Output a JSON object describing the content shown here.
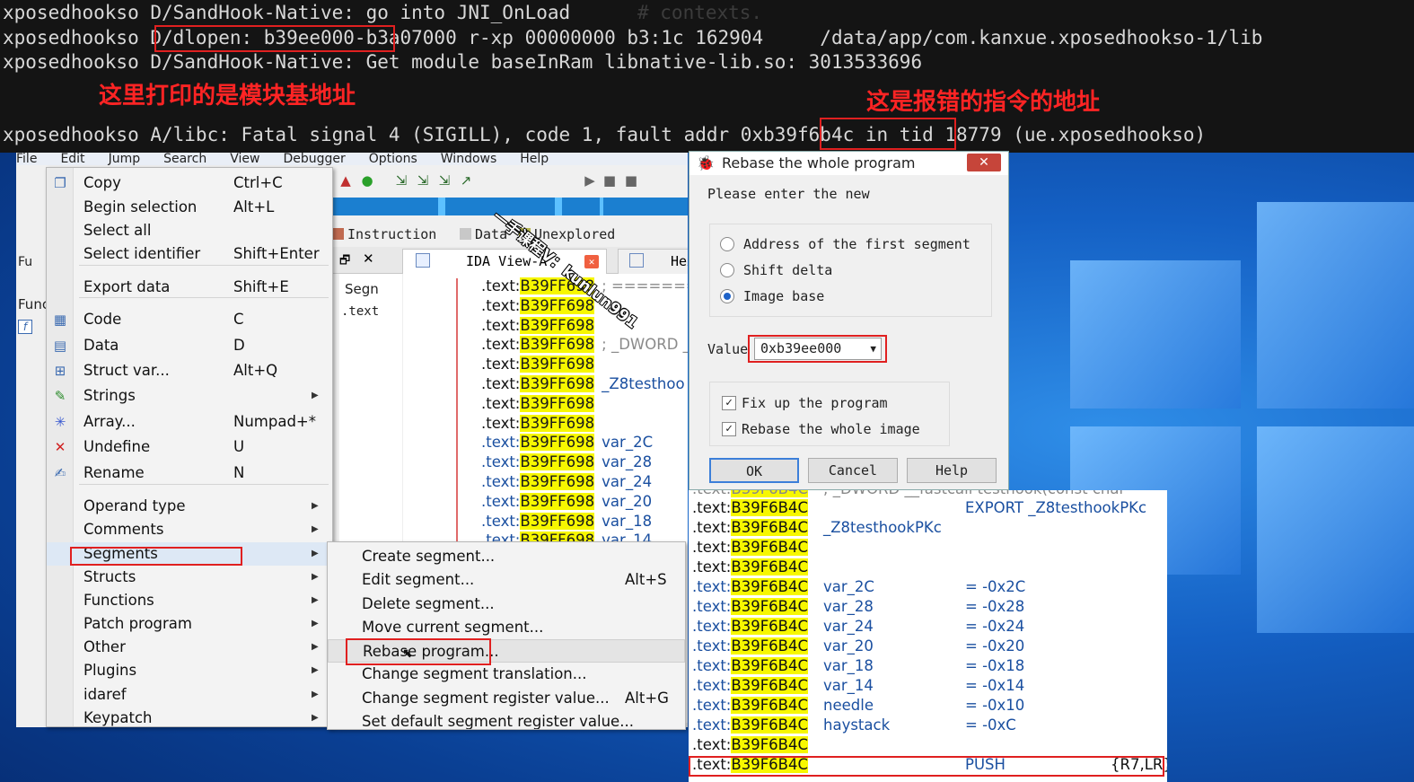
{
  "terminal": {
    "lines": [
      "xposedhookso D/SandHook-Native: go into JNI_OnLoad",
      "xposedhookso D/dlopen: b39ee000-b3a07000 r-xp 00000000 b3:1c 162904     /data/app/com.kanxue.xposedhookso-1/lib",
      "xposedhookso D/SandHook-Native: Get module baseInRam libnative-lib.so: 3013533696",
      "xposedhookso A/libc: Fatal signal 4 (SIGILL), code 1, fault addr 0xb39f6b4c in tid 18779 (ue.xposedhookso)"
    ],
    "ghost": "# contexts.",
    "annotation_left": "这里打印的是模块基地址",
    "annotation_right": "这是报错的指令的地址"
  },
  "ida_menu": [
    "File",
    "Edit",
    "Jump",
    "Search",
    "View",
    "Debugger",
    "Options",
    "Windows",
    "Help"
  ],
  "legend": [
    "Instruction",
    "Data",
    "Unexplored"
  ],
  "tab_ida_view": "IDA View-A",
  "tab_hex": "Hex",
  "side": {
    "functions": "Fu",
    "func": "Func",
    "seg": "Segn",
    "segrow": ".text"
  },
  "disasm": {
    "prefix": ".text:",
    "addr": "B39FF698",
    "rows": [
      {
        "t": "cm",
        "text": "; ==========="
      },
      {
        "t": "",
        "text": ""
      },
      {
        "t": "",
        "text": ""
      },
      {
        "t": "cm",
        "text": "; _DWORD _"
      },
      {
        "t": "",
        "text": ""
      },
      {
        "t": "nm",
        "text": "_Z8testhoo"
      },
      {
        "t": "",
        "text": ""
      },
      {
        "t": "",
        "text": ""
      },
      {
        "t": "var",
        "text": "var_2C"
      },
      {
        "t": "var",
        "text": "var_28"
      },
      {
        "t": "var",
        "text": "var_24"
      },
      {
        "t": "var",
        "text": "var_20"
      },
      {
        "t": "var",
        "text": "var_18"
      },
      {
        "t": "var",
        "text": "var_14"
      }
    ]
  },
  "context_menu": [
    {
      "label": "Copy",
      "shortcut": "Ctrl+C",
      "icon": "copy-icon"
    },
    {
      "label": "Begin selection",
      "shortcut": "Alt+L"
    },
    {
      "label": "Select all",
      "shortcut": ""
    },
    {
      "label": "Select identifier",
      "shortcut": "Shift+Enter"
    },
    {
      "label": "Export data",
      "shortcut": "Shift+E"
    },
    {
      "label": "Code",
      "shortcut": "C",
      "icon": "code-icon"
    },
    {
      "label": "Data",
      "shortcut": "D",
      "icon": "data-icon"
    },
    {
      "label": "Struct var...",
      "shortcut": "Alt+Q",
      "icon": "struct-icon"
    },
    {
      "label": "Strings",
      "shortcut": "",
      "icon": "strings-icon",
      "submenu": true
    },
    {
      "label": "Array...",
      "shortcut": "Numpad+*",
      "icon": "array-icon"
    },
    {
      "label": "Undefine",
      "shortcut": "U",
      "icon": "undefine-icon"
    },
    {
      "label": "Rename",
      "shortcut": "N",
      "icon": "rename-icon"
    },
    {
      "label": "Operand type",
      "shortcut": "",
      "submenu": true
    },
    {
      "label": "Comments",
      "shortcut": "",
      "submenu": true
    },
    {
      "label": "Segments",
      "shortcut": "",
      "submenu": true
    },
    {
      "label": "Structs",
      "shortcut": "",
      "submenu": true
    },
    {
      "label": "Functions",
      "shortcut": "",
      "submenu": true
    },
    {
      "label": "Patch program",
      "shortcut": "",
      "submenu": true
    },
    {
      "label": "Other",
      "shortcut": "",
      "submenu": true
    },
    {
      "label": "Plugins",
      "shortcut": "",
      "submenu": true
    },
    {
      "label": "idaref",
      "shortcut": "",
      "submenu": true
    },
    {
      "label": "Keypatch",
      "shortcut": "",
      "submenu": true
    }
  ],
  "segments_submenu": [
    {
      "label": "Create segment...",
      "shortcut": ""
    },
    {
      "label": "Edit segment...",
      "shortcut": "Alt+S"
    },
    {
      "label": "Delete segment...",
      "shortcut": ""
    },
    {
      "label": "Move current segment...",
      "shortcut": ""
    },
    {
      "label": "Rebase program...",
      "shortcut": ""
    },
    {
      "label": "Change segment translation...",
      "shortcut": ""
    },
    {
      "label": "Change segment register value...",
      "shortcut": "Alt+G"
    },
    {
      "label": "Set default segment register value...",
      "shortcut": ""
    }
  ],
  "dialog": {
    "title": "Rebase the whole program",
    "prompt": "Please enter the new",
    "options": [
      "Address of the first segment",
      "Shift delta",
      "Image base"
    ],
    "selected": "Image base",
    "value_label": "Value",
    "value": "0xb39ee000",
    "checks": [
      "Fix up the program",
      "Rebase the whole image"
    ],
    "ok": "OK",
    "cancel": "Cancel",
    "help": "Help"
  },
  "ida_view2": {
    "prefix": ".text:",
    "addr": "B39F6B4C",
    "top_partial": "; _DWORD __fastcall testhook(const char",
    "rows": [
      {
        "nm": "",
        "val": "EXPORT _Z8testhookPKc"
      },
      {
        "nm": "_Z8testhookPKc",
        "val": ""
      },
      {
        "nm": "",
        "val": ""
      },
      {
        "nm": "",
        "val": ""
      },
      {
        "nm": "var_2C",
        "val": "= -0x2C"
      },
      {
        "nm": "var_28",
        "val": "= -0x28"
      },
      {
        "nm": "var_24",
        "val": "= -0x24"
      },
      {
        "nm": "var_20",
        "val": "= -0x20"
      },
      {
        "nm": "var_18",
        "val": "= -0x18"
      },
      {
        "nm": "var_14",
        "val": "= -0x14"
      },
      {
        "nm": "needle",
        "val": "= -0x10"
      },
      {
        "nm": "haystack",
        "val": "= -0xC"
      },
      {
        "nm": "",
        "val": ""
      }
    ],
    "push_op": "PUSH",
    "push_arg": "{R7,LR}"
  },
  "watermark": "一手课程V：kunlun991",
  "colors": {
    "highlight_yellow": "#f7f700",
    "annotation_red": "#ff2424",
    "terminal_bg": "#141414"
  }
}
